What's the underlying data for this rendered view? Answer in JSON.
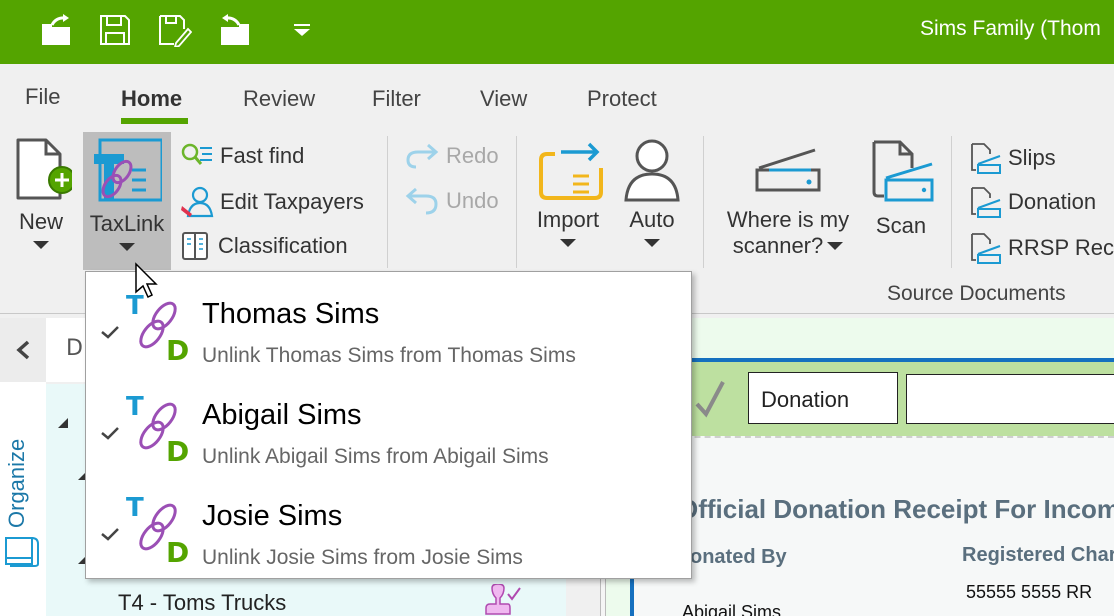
{
  "titlebar": {
    "title": "Sims Family (Thom",
    "quick_access": [
      {
        "icon": "open-file-icon"
      },
      {
        "icon": "save-icon"
      },
      {
        "icon": "save-as-icon"
      },
      {
        "icon": "close-file-icon"
      },
      {
        "icon": "customize-toolbar-icon"
      }
    ]
  },
  "tabs": [
    {
      "label": "File"
    },
    {
      "label": "Home",
      "active": true
    },
    {
      "label": "Review"
    },
    {
      "label": "Filter"
    },
    {
      "label": "View"
    },
    {
      "label": "Protect"
    }
  ],
  "ribbon": {
    "new_label": "New",
    "taxlink_label": "TaxLink",
    "fast_find_label": "Fast find",
    "edit_taxpayers_label": "Edit Taxpayers",
    "classification_label": "Classification",
    "redo_label": "Redo",
    "undo_label": "Undo",
    "import_label": "Import",
    "auto_label": "Auto",
    "where_scanner_line1": "Where is my",
    "where_scanner_line2": "scanner?",
    "scan_label": "Scan",
    "slips_label": "Slips",
    "donation_label": "Donation",
    "rrsp_label": "RRSP Rece",
    "group_source_documents": "Source Documents"
  },
  "taxlink_menu": {
    "items": [
      {
        "name": "Thomas Sims",
        "action": "Unlink Thomas Sims from Thomas Sims",
        "checked": true
      },
      {
        "name": "Abigail Sims",
        "action": "Unlink Abigail Sims from Abigail Sims",
        "checked": true
      },
      {
        "name": "Josie Sims",
        "action": "Unlink Josie Sims from Josie Sims",
        "checked": true
      }
    ],
    "icon_letters": {
      "top": "T",
      "bottom": "D"
    }
  },
  "sidebar": {
    "organize_label": "Organize",
    "header_partial": "D",
    "tree_item": "T4 - Toms Trucks"
  },
  "document": {
    "type_value": "Donation",
    "second_field_value": "",
    "title": "Official Donation Receipt For Incom",
    "donated_by_label": "onated By",
    "registered_charity_label": "Registered Char",
    "charity_number": "55555 5555 RR",
    "donor_name": "Abigail Sims"
  },
  "colors": {
    "brand_green": "#54a400",
    "accent_blue": "#1b9ad2",
    "link_purple": "#9b4fb5",
    "doc_green": "#bde0a0"
  }
}
